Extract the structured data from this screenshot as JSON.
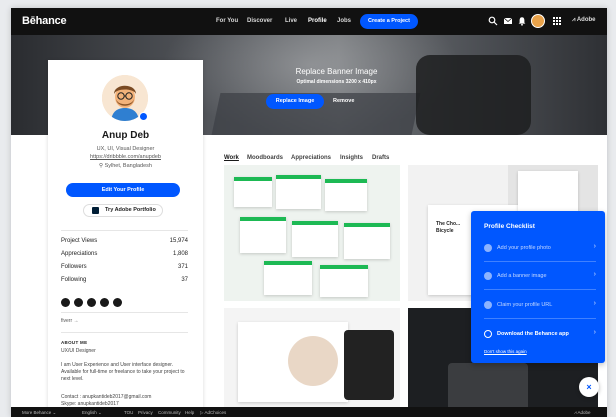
{
  "topnav": {
    "logo": "Bēhance",
    "links": [
      "For You",
      "Discover",
      "Live",
      "Profile",
      "Jobs"
    ],
    "active_link": "Profile",
    "create_label": "Create a Project",
    "adobe_label": "Adobe"
  },
  "banner": {
    "title": "Replace Banner Image",
    "subtitle": "Optimal dimensions 3200 x 410px",
    "replace_label": "Replace Image",
    "remove_label": "Remove"
  },
  "profile": {
    "name": "Anup Deb",
    "role": "UX, UI, Visual Designer",
    "link": "https://dribbble.com/anupdeb",
    "location": "Sylhet, Bangladesh",
    "edit_label": "Edit Your Profile",
    "portfolio_label": "Try Adobe Portfolio",
    "stats": [
      {
        "label": "Project Views",
        "value": "15,974"
      },
      {
        "label": "Appreciations",
        "value": "1,808"
      },
      {
        "label": "Followers",
        "value": "371"
      },
      {
        "label": "Following",
        "value": "37"
      }
    ],
    "social_icons": [
      "facebook-icon",
      "dribbble-icon",
      "github-icon",
      "linkedin-icon",
      "instagram-icon"
    ],
    "fiverr_label": "fiverr →",
    "about_heading": "ABOUT ME",
    "about_lines": [
      "UX/UI Designer",
      "I am User Experience and User interface designer. Available for full-time or freelance to take your project to next level.",
      "Contact : anupkantideb2017@gmail.com",
      "Skype: anupkantideb2017"
    ]
  },
  "tabs": [
    "Work",
    "Moodboards",
    "Appreciations",
    "Insights",
    "Drafts"
  ],
  "gallery": {
    "thumb2_text": "The Cho... Bicycle"
  },
  "checklist": {
    "title": "Profile Checklist",
    "items": [
      {
        "label": "Add your profile photo",
        "done": true
      },
      {
        "label": "Add a banner image",
        "done": true
      },
      {
        "label": "Claim your profile URL",
        "done": true
      },
      {
        "label": "Download the Behance app",
        "done": false
      }
    ],
    "dismiss_label": "Don't show this again",
    "close_label": "×"
  },
  "footer": {
    "links": [
      "More Behance ⌄",
      "English ⌄",
      "TOU",
      "Privacy",
      "Community",
      "Help",
      "AdChoices"
    ],
    "adobe_label": "Adobe"
  },
  "colors": {
    "accent": "#0057ff",
    "nav_bg": "#111111"
  }
}
